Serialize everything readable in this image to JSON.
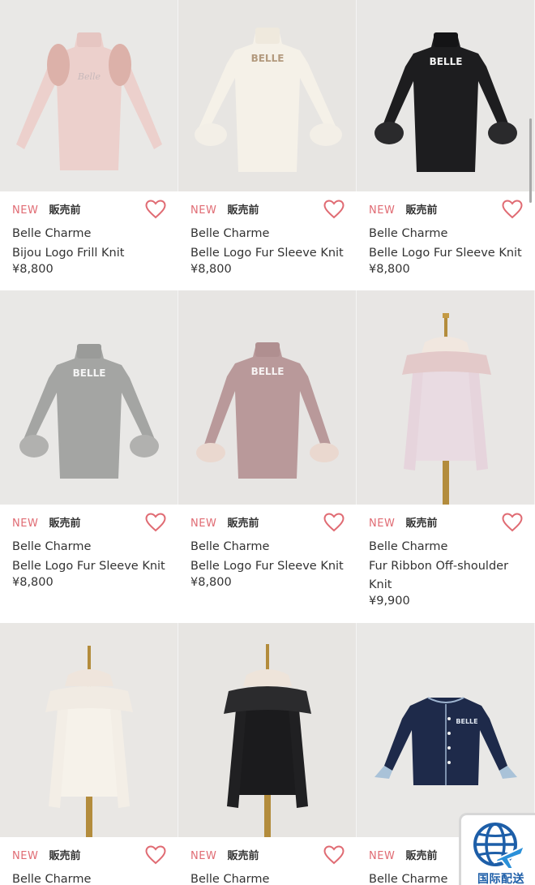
{
  "colors": {
    "accent_new": "#e06b73",
    "heart": "#e06b73",
    "text": "#333333",
    "shipping_blue": "#1d5ea8"
  },
  "products": [
    {
      "tag_new": "NEW",
      "tag_status": "販売前",
      "brand": "Belle Charme",
      "name": "Bijou Logo Frill Knit",
      "price": "¥8,800",
      "garment": "pink-frill-knit"
    },
    {
      "tag_new": "NEW",
      "tag_status": "販売前",
      "brand": "Belle Charme",
      "name": "Belle Logo Fur Sleeve Knit",
      "price": "¥8,800",
      "garment": "ivory-fur-sleeve-knit"
    },
    {
      "tag_new": "NEW",
      "tag_status": "販売前",
      "brand": "Belle Charme",
      "name": "Belle Logo Fur Sleeve Knit",
      "price": "¥8,800",
      "garment": "black-fur-sleeve-knit"
    },
    {
      "tag_new": "NEW",
      "tag_status": "販売前",
      "brand": "Belle Charme",
      "name": "Belle Logo Fur Sleeve Knit",
      "price": "¥8,800",
      "garment": "gray-fur-sleeve-knit"
    },
    {
      "tag_new": "NEW",
      "tag_status": "販売前",
      "brand": "Belle Charme",
      "name": "Belle Logo Fur Sleeve Knit",
      "price": "¥8,800",
      "garment": "mauve-fur-sleeve-knit"
    },
    {
      "tag_new": "NEW",
      "tag_status": "販売前",
      "brand": "Belle Charme",
      "name": "Fur Ribbon Off-shoulder Knit",
      "price": "¥9,900",
      "garment": "lilac-off-shoulder-knit"
    },
    {
      "tag_new": "NEW",
      "tag_status": "販売前",
      "brand": "Belle Charme",
      "garment": "ivory-off-shoulder-knit"
    },
    {
      "tag_new": "NEW",
      "tag_status": "販売前",
      "brand": "Belle Charme",
      "garment": "black-off-shoulder-knit"
    },
    {
      "tag_new": "NEW",
      "tag_status": "販売前",
      "brand": "Belle Charme",
      "garment": "navy-cardigan"
    }
  ],
  "shipping_badge": {
    "label": "国际配送",
    "icon": "globe-airplane-icon"
  }
}
